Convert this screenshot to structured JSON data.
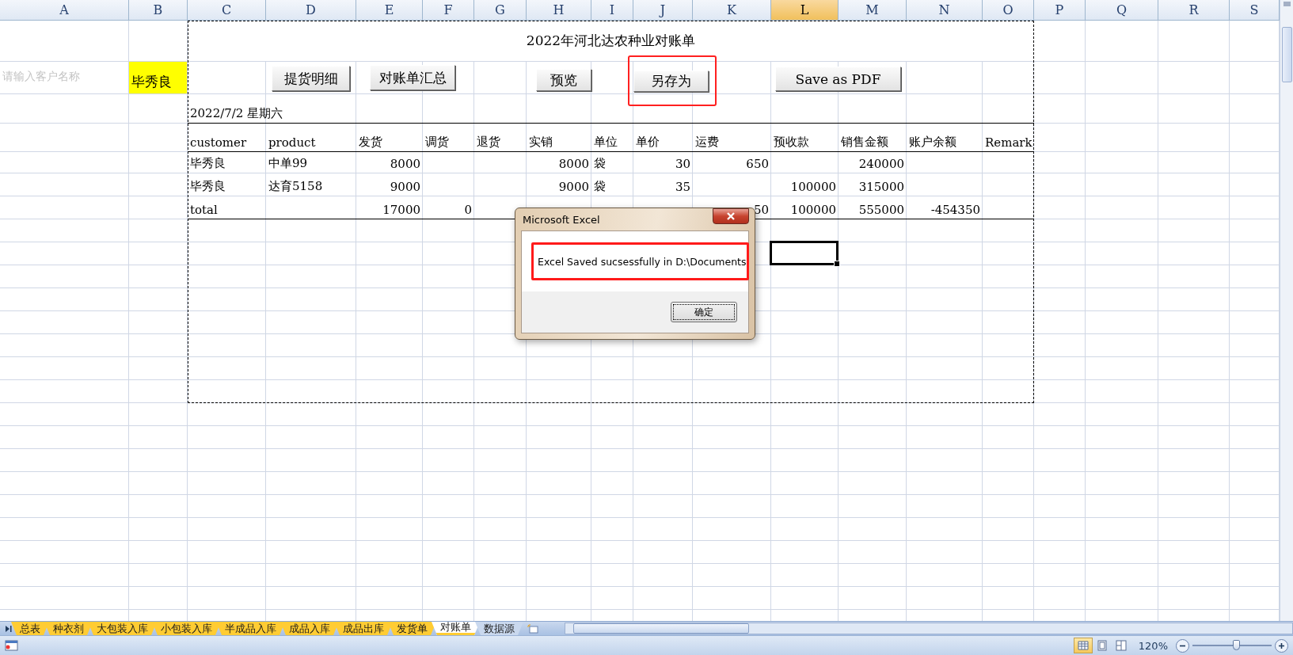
{
  "sheet": {
    "columns": [
      {
        "label": "A",
        "selected": false
      },
      {
        "label": "B",
        "selected": false
      },
      {
        "label": "C",
        "selected": false
      },
      {
        "label": "D",
        "selected": false
      },
      {
        "label": "E",
        "selected": false
      },
      {
        "label": "F",
        "selected": false
      },
      {
        "label": "G",
        "selected": false
      },
      {
        "label": "H",
        "selected": false
      },
      {
        "label": "I",
        "selected": false
      },
      {
        "label": "J",
        "selected": false
      },
      {
        "label": "K",
        "selected": false
      },
      {
        "label": "L",
        "selected": true
      },
      {
        "label": "M",
        "selected": false
      },
      {
        "label": "N",
        "selected": false
      },
      {
        "label": "O",
        "selected": false
      },
      {
        "label": "P",
        "selected": false
      },
      {
        "label": "Q",
        "selected": false
      },
      {
        "label": "R",
        "selected": false
      },
      {
        "label": "S",
        "selected": false
      }
    ],
    "title": "2022年河北达农种业对账单",
    "hint": "请输入客户名称",
    "customer": "毕秀良",
    "date": "2022/7/2 星期六",
    "buttons": [
      {
        "label": "提货明细",
        "highlighted": false
      },
      {
        "label": "对账单汇总",
        "highlighted": false
      },
      {
        "label": "预览",
        "highlighted": false
      },
      {
        "label": "另存为",
        "highlighted": true
      },
      {
        "label": "Save as PDF",
        "highlighted": false
      }
    ],
    "table": {
      "header": [
        "customer",
        "product",
        "发货",
        "调货",
        "退货",
        "实销",
        "单位",
        "单价",
        "运费",
        "预收款",
        "销售金额",
        "账户余额",
        "Remark"
      ],
      "rows": [
        {
          "cells": [
            {
              "text": "毕秀良",
              "kind": "text"
            },
            {
              "text": "中单99",
              "kind": "text"
            },
            {
              "text": "8000",
              "kind": "number"
            },
            null,
            null,
            {
              "text": "8000",
              "kind": "number"
            },
            {
              "text": "袋",
              "kind": "text"
            },
            {
              "text": "30",
              "kind": "number"
            },
            {
              "text": "650",
              "kind": "number"
            },
            null,
            {
              "text": "240000",
              "kind": "number"
            },
            null,
            null
          ]
        },
        {
          "cells": [
            {
              "text": "毕秀良",
              "kind": "text"
            },
            {
              "text": "达育5158",
              "kind": "text"
            },
            {
              "text": "9000",
              "kind": "number"
            },
            null,
            null,
            {
              "text": "9000",
              "kind": "number"
            },
            {
              "text": "袋",
              "kind": "text"
            },
            {
              "text": "35",
              "kind": "number"
            },
            null,
            {
              "text": "100000",
              "kind": "number"
            },
            {
              "text": "315000",
              "kind": "number"
            },
            null,
            null
          ]
        },
        {
          "cells": [
            {
              "text": "total",
              "kind": "text"
            },
            null,
            {
              "text": "17000",
              "kind": "number"
            },
            {
              "text": "0",
              "kind": "number"
            },
            null,
            null,
            null,
            null,
            {
              "text": "50",
              "kind": "number"
            },
            {
              "text": "100000",
              "kind": "number"
            },
            {
              "text": "555000",
              "kind": "number"
            },
            {
              "text": "-454350",
              "kind": "number"
            },
            null
          ]
        }
      ]
    },
    "extra_rows": [
      {
        "selected": false
      },
      {
        "selected": true
      },
      {
        "selected": false
      },
      {
        "selected": false
      },
      {
        "selected": false
      },
      {
        "selected": false
      },
      {
        "selected": false
      },
      {
        "selected": false
      }
    ]
  },
  "dialog": {
    "title": "Microsoft Excel",
    "message": "Excel Saved sucsessfully in D:\\Documents",
    "highlighted": true,
    "button": "确定"
  },
  "sheet_tabs": [
    {
      "label": "总表",
      "selected": false,
      "color": "#ffcc33"
    },
    {
      "label": "种衣剂",
      "selected": false,
      "color": "#ffcc33"
    },
    {
      "label": "大包装入库",
      "selected": false,
      "color": "#ffcc33"
    },
    {
      "label": "小包装入库",
      "selected": false,
      "color": "#ffcc33"
    },
    {
      "label": "半成品入库",
      "selected": false,
      "color": "#ffcc33"
    },
    {
      "label": "成品入库",
      "selected": false,
      "color": "#ffcc33"
    },
    {
      "label": "成品出库",
      "selected": false,
      "color": "#ffcc33"
    },
    {
      "label": "发货单",
      "selected": false,
      "color": "#ffcc33"
    },
    {
      "label": "对账单",
      "selected": true,
      "color": "#ffcc33"
    },
    {
      "label": "数据源",
      "selected": false,
      "color": "#c9d8ee"
    }
  ],
  "status_bar": {
    "zoom": "120%",
    "zoom_slider": {
      "level": 0.55
    }
  }
}
